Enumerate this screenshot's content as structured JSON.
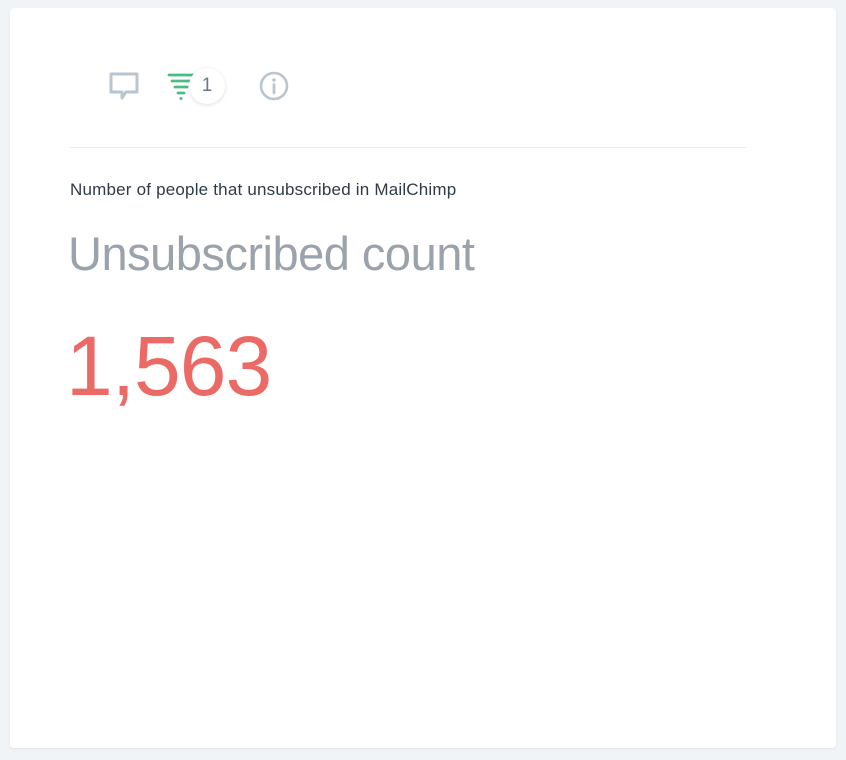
{
  "toolbar": {
    "filter_count": "1",
    "icons": [
      "comment-icon",
      "filter-icon",
      "info-icon"
    ]
  },
  "widget": {
    "description": "Number of people that unsubscribed in MailChimp",
    "title": "Unsubscribed count",
    "value": "1,563"
  },
  "colors": {
    "metric": "#ec6a66",
    "filter_icon": "#4cbc86",
    "toolbar_icon": "#b9c6d1",
    "title": "#9aa2ab",
    "description": "#2e3b48"
  }
}
